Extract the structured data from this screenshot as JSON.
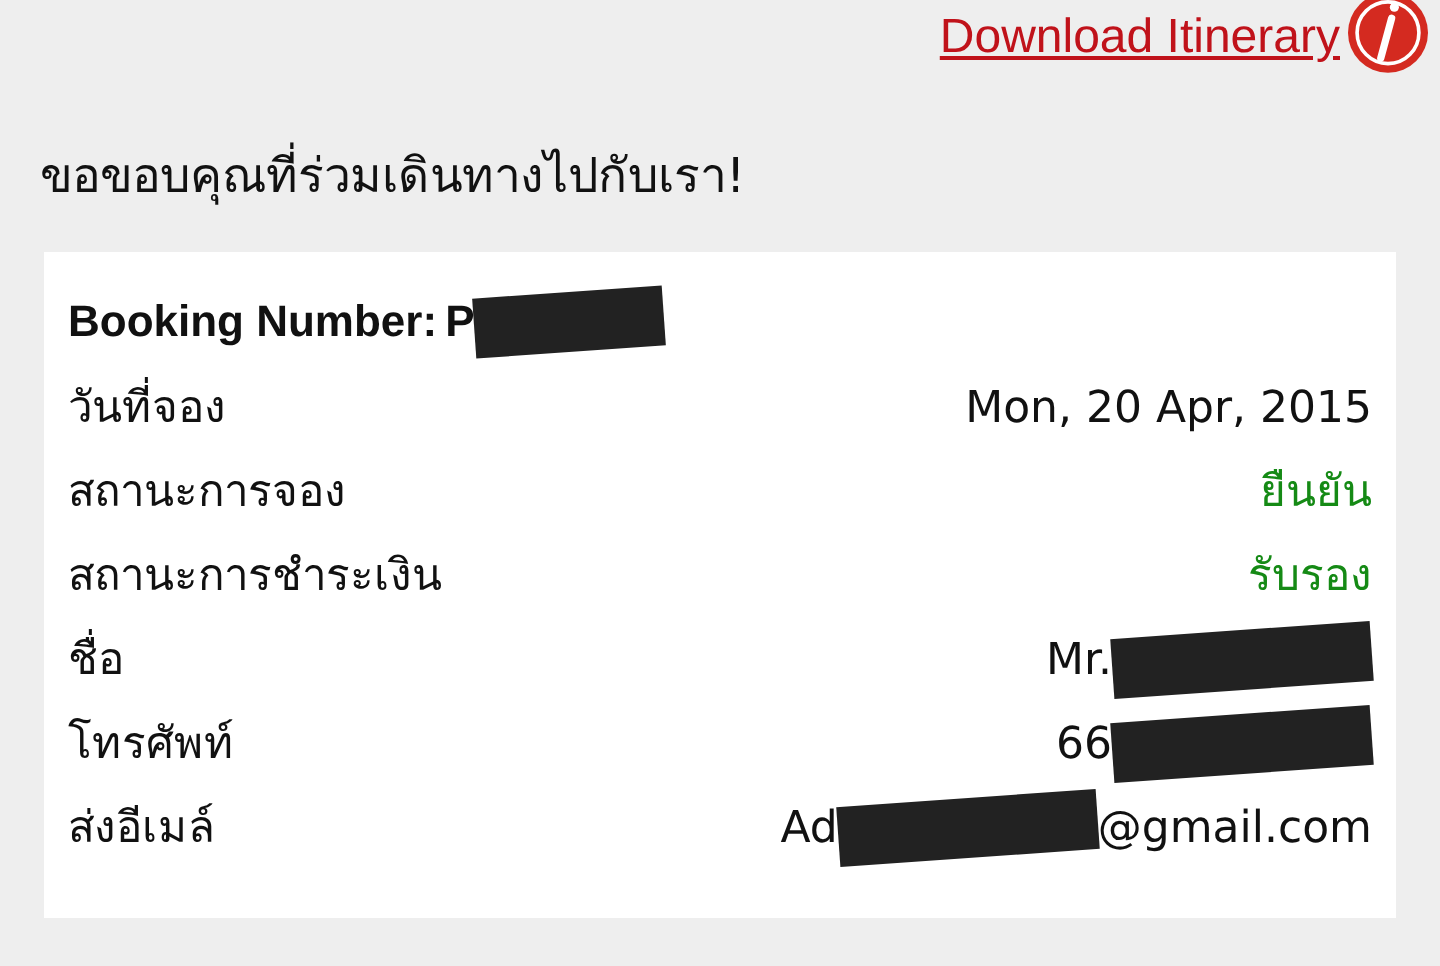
{
  "download_link": {
    "text": "Download Itinerary"
  },
  "heading": "ขอขอบคุณที่ร่วมเดินทางไปกับเรา!",
  "booking": {
    "label": "Booking Number:",
    "value_parts": [
      {
        "kind": "text",
        "text": "P"
      },
      {
        "kind": "redacted"
      }
    ]
  },
  "rows": [
    {
      "label": "วันที่จอง",
      "color": "#111111",
      "value_parts": [
        {
          "kind": "text",
          "text": "Mon, 20 Apr, 2015"
        }
      ]
    },
    {
      "label": "สถานะการจอง",
      "color": "#158a15",
      "value_parts": [
        {
          "kind": "text",
          "text": "ยืนยัน"
        }
      ]
    },
    {
      "label": "สถานะการชำระเงิน",
      "color": "#158a15",
      "value_parts": [
        {
          "kind": "text",
          "text": "รับรอง"
        }
      ]
    },
    {
      "label": "ชื่อ",
      "color": "#111111",
      "value_parts": [
        {
          "kind": "text",
          "text": "Mr."
        },
        {
          "kind": "redacted"
        }
      ]
    },
    {
      "label": "โทรศัพท์",
      "color": "#111111",
      "value_parts": [
        {
          "kind": "text",
          "text": "66"
        },
        {
          "kind": "redacted"
        }
      ]
    },
    {
      "label": "ส่งอีเมล์",
      "color": "#111111",
      "value_parts": [
        {
          "kind": "text",
          "text": "Ad"
        },
        {
          "kind": "redacted"
        },
        {
          "kind": "text",
          "text": "@gmail.com"
        }
      ]
    }
  ]
}
